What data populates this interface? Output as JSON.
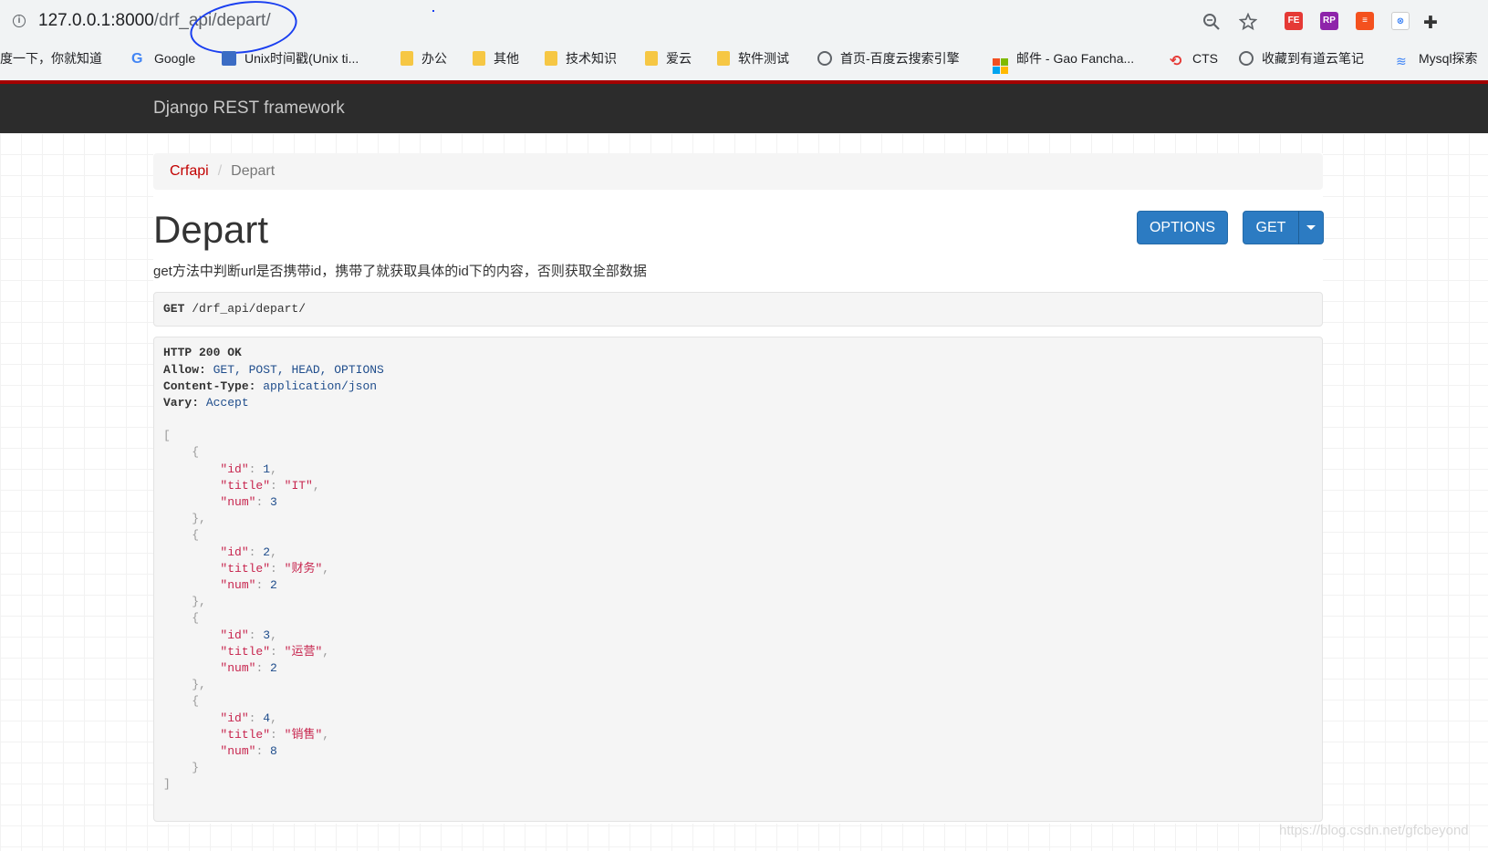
{
  "browser": {
    "url_host": "127.0.0.1:8000",
    "url_path": "/drf_api/depart/",
    "bookmarks": [
      {
        "label": "度一下，你就知道",
        "icon": "none"
      },
      {
        "label": "Google",
        "icon": "google-icon"
      },
      {
        "label": "Unix时间戳(Unix ti...",
        "icon": "unix-icon"
      },
      {
        "label": "办公",
        "icon": "folder-icon"
      },
      {
        "label": "其他",
        "icon": "folder-icon"
      },
      {
        "label": "技术知识",
        "icon": "folder-icon"
      },
      {
        "label": "爱云",
        "icon": "folder-icon"
      },
      {
        "label": "软件测试",
        "icon": "folder-icon"
      },
      {
        "label": "首页-百度云搜索引擎",
        "icon": "globe-icon"
      },
      {
        "label": "邮件 - Gao Fancha...",
        "icon": "microsoft-icon"
      },
      {
        "label": "CTS",
        "icon": "cts-icon"
      },
      {
        "label": "收藏到有道云笔记",
        "icon": "globe-icon"
      },
      {
        "label": "Mysql探索",
        "icon": "mysql-icon"
      }
    ],
    "extensions": [
      "FE",
      "RP",
      "≡",
      "⊗"
    ]
  },
  "navbar": {
    "brand": "Django REST framework"
  },
  "breadcrumb": {
    "root": "Crfapi",
    "separator": "/",
    "current": "Depart"
  },
  "page": {
    "title": "Depart",
    "description": "get方法中判断url是否携带id，携带了就获取具体的id下的内容，否则获取全部数据"
  },
  "buttons": {
    "options": "OPTIONS",
    "get": "GET"
  },
  "request": {
    "method": "GET",
    "path": "/drf_api/depart/"
  },
  "response": {
    "status": "HTTP 200 OK",
    "headers": [
      {
        "key": "Allow:",
        "value": "GET, POST, HEAD, OPTIONS"
      },
      {
        "key": "Content-Type:",
        "value": "application/json"
      },
      {
        "key": "Vary:",
        "value": "Accept"
      }
    ],
    "body": [
      {
        "id": "1",
        "title": "\"IT\"",
        "num": "3"
      },
      {
        "id": "2",
        "title": "\"财务\"",
        "num": "2"
      },
      {
        "id": "3",
        "title": "\"运营\"",
        "num": "2"
      },
      {
        "id": "4",
        "title": "\"销售\"",
        "num": "8"
      }
    ]
  },
  "watermark": "https://blog.csdn.net/gfcbeyond"
}
